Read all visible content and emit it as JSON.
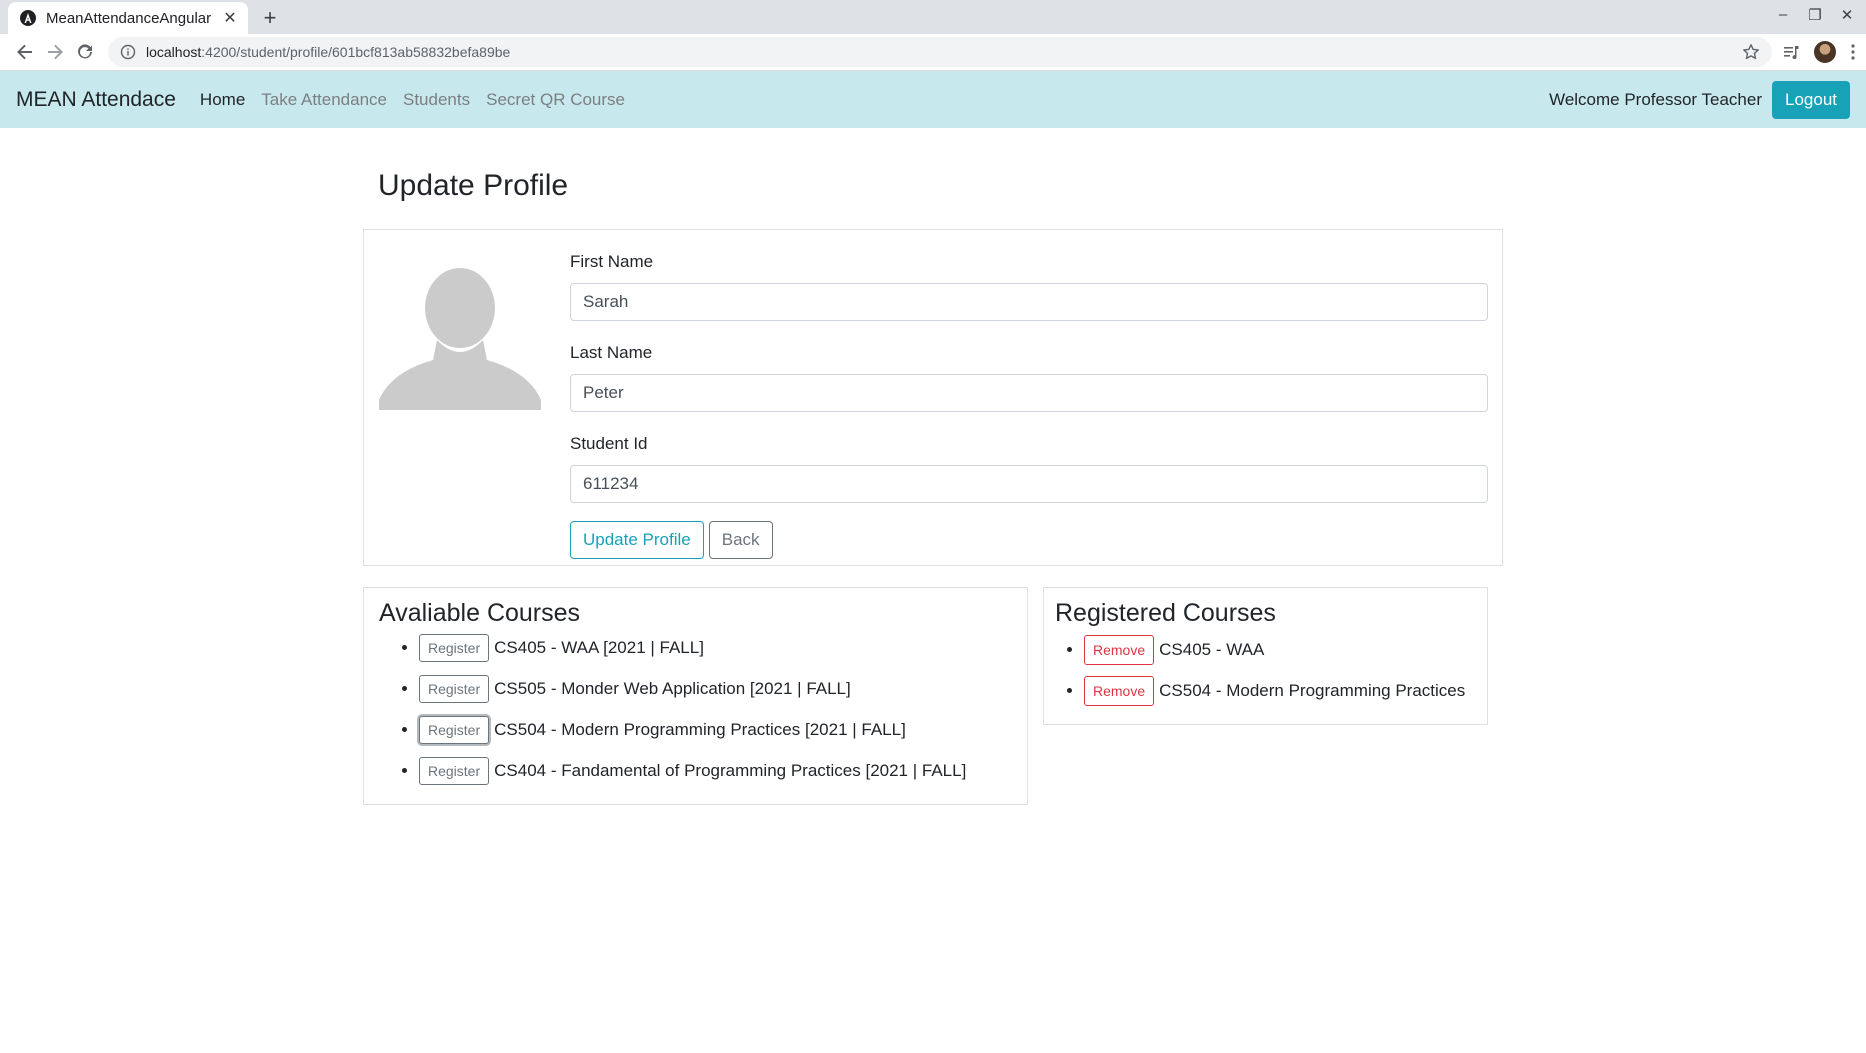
{
  "browser": {
    "tab_title": "MeanAttendanceAngular",
    "url_host": "localhost",
    "url_path": ":4200/student/profile/601bcf813ab58832befa89be"
  },
  "navbar": {
    "brand": "MEAN Attendace",
    "links": [
      "Home",
      "Take Attendance",
      "Students",
      "Secret QR Course"
    ],
    "welcome": "Welcome Professor Teacher",
    "logout": "Logout"
  },
  "page": {
    "title": "Update Profile"
  },
  "form": {
    "first_name_label": "First Name",
    "first_name_value": "Sarah",
    "last_name_label": "Last Name",
    "last_name_value": "Peter",
    "student_id_label": "Student Id",
    "student_id_value": "611234",
    "update_button": "Update Profile",
    "back_button": "Back"
  },
  "available": {
    "title": "Avaliable Courses",
    "register_label": "Register",
    "courses": [
      "CS405 - WAA [2021 | FALL]",
      "CS505 - Monder Web Application [2021 | FALL]",
      "CS504 - Modern Programming Practices [2021 | FALL]",
      "CS404 - Fandamental of Programming Practices [2021 | FALL]"
    ]
  },
  "registered": {
    "title": "Registered Courses",
    "remove_label": "Remove",
    "courses": [
      "CS405 - WAA",
      "CS504 - Modern Programming Practices"
    ]
  },
  "colors": {
    "navbar_bg": "#c7e8ed",
    "info": "#17a2b8",
    "danger": "#dc3545",
    "secondary": "#6c757d"
  },
  "icons": [
    "angular-favicon",
    "back-arrow-icon",
    "forward-arrow-icon",
    "reload-icon",
    "info-icon",
    "star-icon",
    "reading-list-icon",
    "menu-icon",
    "avatar-placeholder-icon"
  ]
}
